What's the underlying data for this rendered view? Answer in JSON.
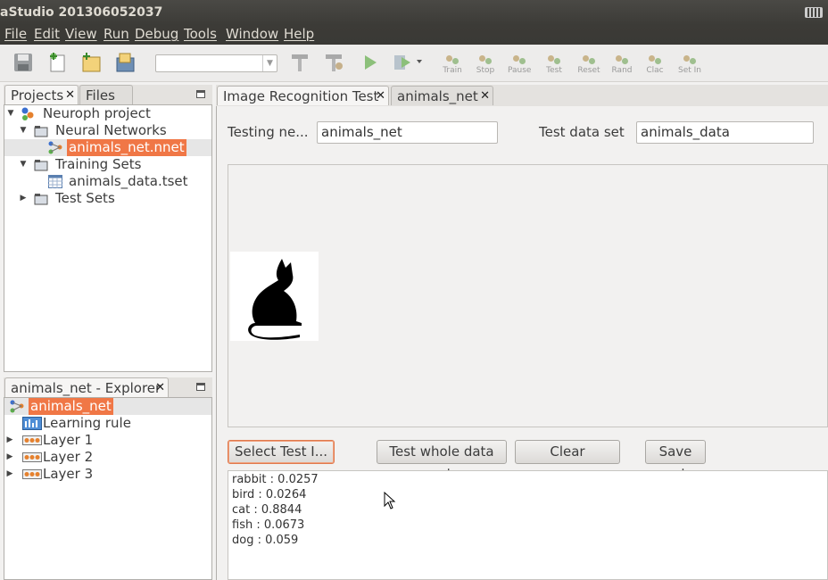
{
  "window": {
    "title": "aStudio 201306052037"
  },
  "menu": [
    "File",
    "Edit",
    "View",
    "Run",
    "Debug",
    "Tools",
    "Window",
    "Help"
  ],
  "toolbar": {
    "labeled_buttons": [
      "Train",
      "Stop",
      "Pause",
      "Test",
      "Reset",
      "Rand",
      "Clac",
      "Set In"
    ],
    "combo_value": ""
  },
  "projects_panel": {
    "tabs": [
      "Projects",
      "Files"
    ],
    "tree": {
      "project": "Neuroph project",
      "neural_networks": "Neural Networks",
      "network_file": "animals_net.nnet",
      "training_sets": "Training Sets",
      "data_file": "animals_data.tset",
      "test_sets": "Test Sets"
    }
  },
  "explorer_panel": {
    "tab": "animals_net - Explorer",
    "root": "animals_net",
    "items": [
      "Learning rule",
      "Layer 1",
      "Layer 2",
      "Layer 3"
    ]
  },
  "editor": {
    "tabs": [
      "Image Recognition Test",
      "animals_net"
    ],
    "testing_network_label": "Testing ne...",
    "testing_network_value": "animals_net",
    "test_data_set_label": "Test data set",
    "test_data_set_value": "animals_data",
    "buttons": {
      "select": "Select Test I...",
      "test_whole": "Test whole data set",
      "clear": "Clear",
      "save": "Save net"
    },
    "results": [
      "rabbit : 0.0257",
      "bird : 0.0264",
      "cat : 0.8844",
      "fish : 0.0673",
      "dog : 0.059"
    ]
  },
  "colors": {
    "selection": "#f07746",
    "titlebar": "#3c3b37"
  }
}
